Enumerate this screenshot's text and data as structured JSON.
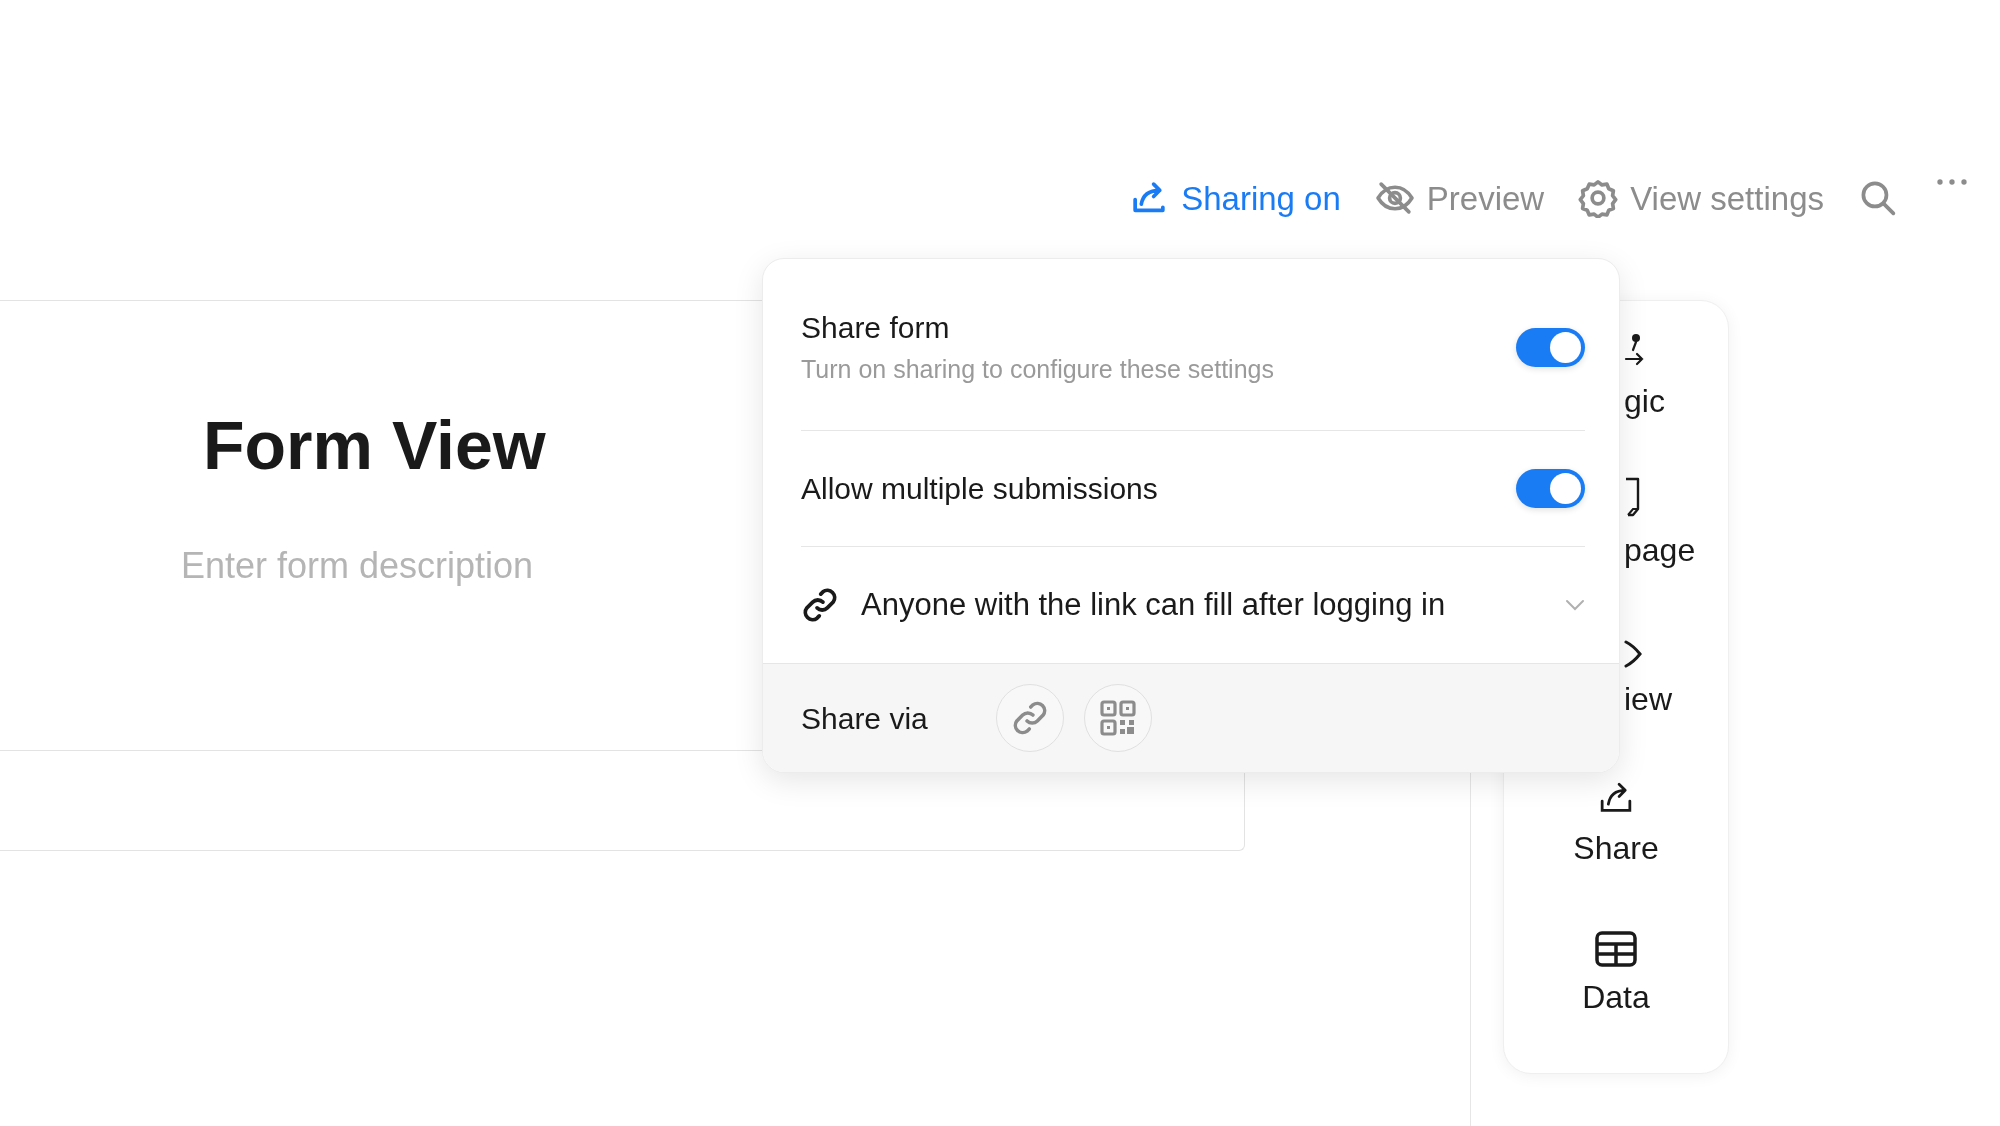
{
  "toolbar": [
    {
      "kind": "share",
      "label": "Sharing on",
      "active": true
    },
    {
      "kind": "preview",
      "label": "Preview",
      "active": false
    },
    {
      "kind": "settings",
      "label": "View settings",
      "active": false
    },
    {
      "kind": "search"
    },
    {
      "kind": "more"
    }
  ],
  "form": {
    "title": "Form View",
    "placeholder": "Enter form description"
  },
  "sidebar": {
    "items": [
      {
        "kind": "logic",
        "label": "gic"
      },
      {
        "kind": "page",
        "label": "page"
      },
      {
        "kind": "preview",
        "label": "iew"
      },
      {
        "kind": "share",
        "label": "Share"
      },
      {
        "kind": "data",
        "label": "Data"
      }
    ]
  },
  "share_popover": {
    "rows": [
      {
        "title": "Share form",
        "subtitle": "Turn on sharing to configure these settings",
        "on": true
      },
      {
        "title": "Allow multiple submissions",
        "on": true
      }
    ],
    "access": {
      "label": "Anyone with the link can fill after logging in"
    },
    "share_via": {
      "label": "Share via",
      "options": [
        {
          "kind": "link"
        },
        {
          "kind": "qr"
        }
      ]
    }
  }
}
